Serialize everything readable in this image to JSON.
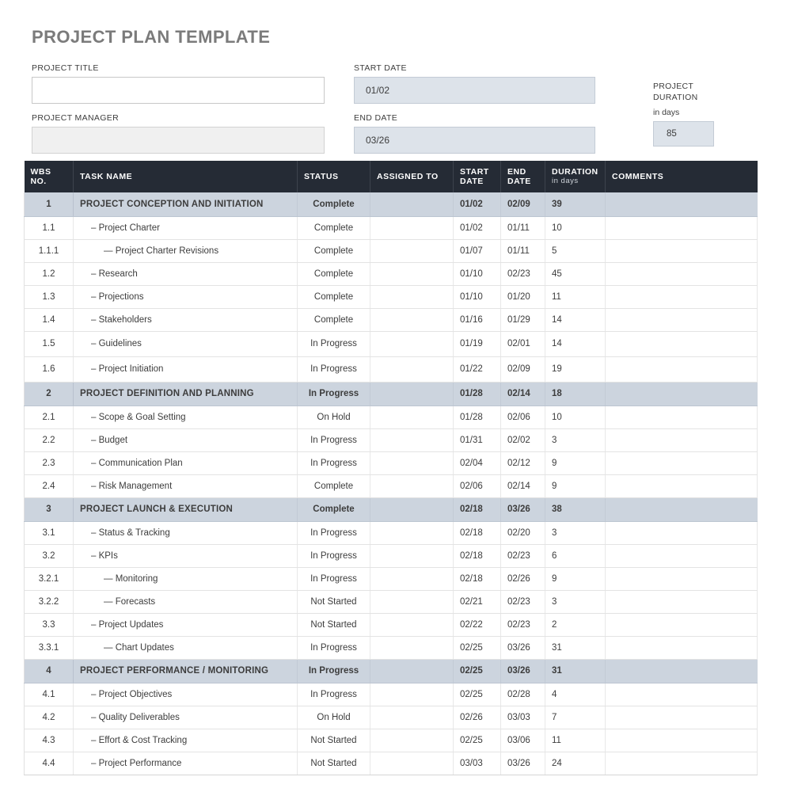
{
  "title": "PROJECT PLAN TEMPLATE",
  "form": {
    "project_title_label": "PROJECT TITLE",
    "project_title_value": "",
    "project_manager_label": "PROJECT MANAGER",
    "project_manager_value": "",
    "start_date_label": "START DATE",
    "start_date_value": "01/02",
    "end_date_label": "END DATE",
    "end_date_value": "03/26",
    "duration_label_line1": "PROJECT",
    "duration_label_line2": "DURATION",
    "duration_sub": "in days",
    "duration_value": "85"
  },
  "table": {
    "headers": {
      "wbs_line1": "WBS",
      "wbs_line2": "NO.",
      "task_name": "TASK NAME",
      "status": "STATUS",
      "assigned_to": "ASSIGNED TO",
      "start_line1": "START",
      "start_line2": "DATE",
      "end_line1": "END",
      "end_line2": "DATE",
      "duration": "DURATION",
      "duration_sub": "in days",
      "comments": "COMMENTS"
    },
    "rows": [
      {
        "wbs": "1",
        "task": "PROJECT CONCEPTION AND INITIATION",
        "level": 1,
        "status": "Complete",
        "assigned": "",
        "start": "01/02",
        "end": "02/09",
        "duration": "39",
        "comments": ""
      },
      {
        "wbs": "1.1",
        "task": "– Project Charter",
        "level": 2,
        "status": "Complete",
        "assigned": "",
        "start": "01/02",
        "end": "01/11",
        "duration": "10",
        "comments": ""
      },
      {
        "wbs": "1.1.1",
        "task": "— Project Charter Revisions",
        "level": 3,
        "status": "Complete",
        "assigned": "",
        "start": "01/07",
        "end": "01/11",
        "duration": "5",
        "comments": ""
      },
      {
        "wbs": "1.2",
        "task": "– Research",
        "level": 2,
        "status": "Complete",
        "assigned": "",
        "start": "01/10",
        "end": "02/23",
        "duration": "45",
        "comments": ""
      },
      {
        "wbs": "1.3",
        "task": "– Projections",
        "level": 2,
        "status": "Complete",
        "assigned": "",
        "start": "01/10",
        "end": "01/20",
        "duration": "11",
        "comments": ""
      },
      {
        "wbs": "1.4",
        "task": "– Stakeholders",
        "level": 2,
        "status": "Complete",
        "assigned": "",
        "start": "01/16",
        "end": "01/29",
        "duration": "14",
        "comments": ""
      },
      {
        "wbs": "1.5",
        "task": "– Guidelines",
        "level": 2,
        "status": "In Progress",
        "assigned": "",
        "start": "01/19",
        "end": "02/01",
        "duration": "14",
        "comments": ""
      },
      {
        "wbs": "1.6",
        "task": "– Project Initiation",
        "level": 2,
        "status": "In Progress",
        "assigned": "",
        "start": "01/22",
        "end": "02/09",
        "duration": "19",
        "comments": ""
      },
      {
        "wbs": "2",
        "task": "PROJECT DEFINITION AND PLANNING",
        "level": 1,
        "status": "In Progress",
        "assigned": "",
        "start": "01/28",
        "end": "02/14",
        "duration": "18",
        "comments": ""
      },
      {
        "wbs": "2.1",
        "task": "– Scope & Goal Setting",
        "level": 2,
        "status": "On Hold",
        "assigned": "",
        "start": "01/28",
        "end": "02/06",
        "duration": "10",
        "comments": ""
      },
      {
        "wbs": "2.2",
        "task": "– Budget",
        "level": 2,
        "status": "In Progress",
        "assigned": "",
        "start": "01/31",
        "end": "02/02",
        "duration": "3",
        "comments": ""
      },
      {
        "wbs": "2.3",
        "task": "– Communication Plan",
        "level": 2,
        "status": "In Progress",
        "assigned": "",
        "start": "02/04",
        "end": "02/12",
        "duration": "9",
        "comments": ""
      },
      {
        "wbs": "2.4",
        "task": "– Risk Management",
        "level": 2,
        "status": "Complete",
        "assigned": "",
        "start": "02/06",
        "end": "02/14",
        "duration": "9",
        "comments": ""
      },
      {
        "wbs": "3",
        "task": "PROJECT LAUNCH & EXECUTION",
        "level": 1,
        "status": "Complete",
        "assigned": "",
        "start": "02/18",
        "end": "03/26",
        "duration": "38",
        "comments": ""
      },
      {
        "wbs": "3.1",
        "task": "– Status & Tracking",
        "level": 2,
        "status": "In Progress",
        "assigned": "",
        "start": "02/18",
        "end": "02/20",
        "duration": "3",
        "comments": ""
      },
      {
        "wbs": "3.2",
        "task": "– KPIs",
        "level": 2,
        "status": "In Progress",
        "assigned": "",
        "start": "02/18",
        "end": "02/23",
        "duration": "6",
        "comments": ""
      },
      {
        "wbs": "3.2.1",
        "task": "— Monitoring",
        "level": 3,
        "status": "In Progress",
        "assigned": "",
        "start": "02/18",
        "end": "02/26",
        "duration": "9",
        "comments": ""
      },
      {
        "wbs": "3.2.2",
        "task": "— Forecasts",
        "level": 3,
        "status": "Not Started",
        "assigned": "",
        "start": "02/21",
        "end": "02/23",
        "duration": "3",
        "comments": ""
      },
      {
        "wbs": "3.3",
        "task": "– Project Updates",
        "level": 2,
        "status": "Not Started",
        "assigned": "",
        "start": "02/22",
        "end": "02/23",
        "duration": "2",
        "comments": ""
      },
      {
        "wbs": "3.3.1",
        "task": "— Chart Updates",
        "level": 3,
        "status": "In Progress",
        "assigned": "",
        "start": "02/25",
        "end": "03/26",
        "duration": "31",
        "comments": ""
      },
      {
        "wbs": "4",
        "task": "PROJECT PERFORMANCE / MONITORING",
        "level": 1,
        "status": "In Progress",
        "assigned": "",
        "start": "02/25",
        "end": "03/26",
        "duration": "31",
        "comments": ""
      },
      {
        "wbs": "4.1",
        "task": "– Project Objectives",
        "level": 2,
        "status": "In Progress",
        "assigned": "",
        "start": "02/25",
        "end": "02/28",
        "duration": "4",
        "comments": ""
      },
      {
        "wbs": "4.2",
        "task": "– Quality Deliverables",
        "level": 2,
        "status": "On Hold",
        "assigned": "",
        "start": "02/26",
        "end": "03/03",
        "duration": "7",
        "comments": ""
      },
      {
        "wbs": "4.3",
        "task": "– Effort & Cost Tracking",
        "level": 2,
        "status": "Not Started",
        "assigned": "",
        "start": "02/25",
        "end": "03/06",
        "duration": "11",
        "comments": ""
      },
      {
        "wbs": "4.4",
        "task": "– Project Performance",
        "level": 2,
        "status": "Not Started",
        "assigned": "",
        "start": "03/03",
        "end": "03/26",
        "duration": "24",
        "comments": ""
      }
    ]
  },
  "colors": {
    "header_bar": "#252b35",
    "section_row": "#ccd4de",
    "status_complete": "#d4dae2",
    "status_in_progress": "#e8ecf1",
    "status_on_hold": "#d4d4d4",
    "status_not_started": "#eeeeee",
    "date_field": "#dde3ea",
    "title_text": "#7b7b7b"
  }
}
